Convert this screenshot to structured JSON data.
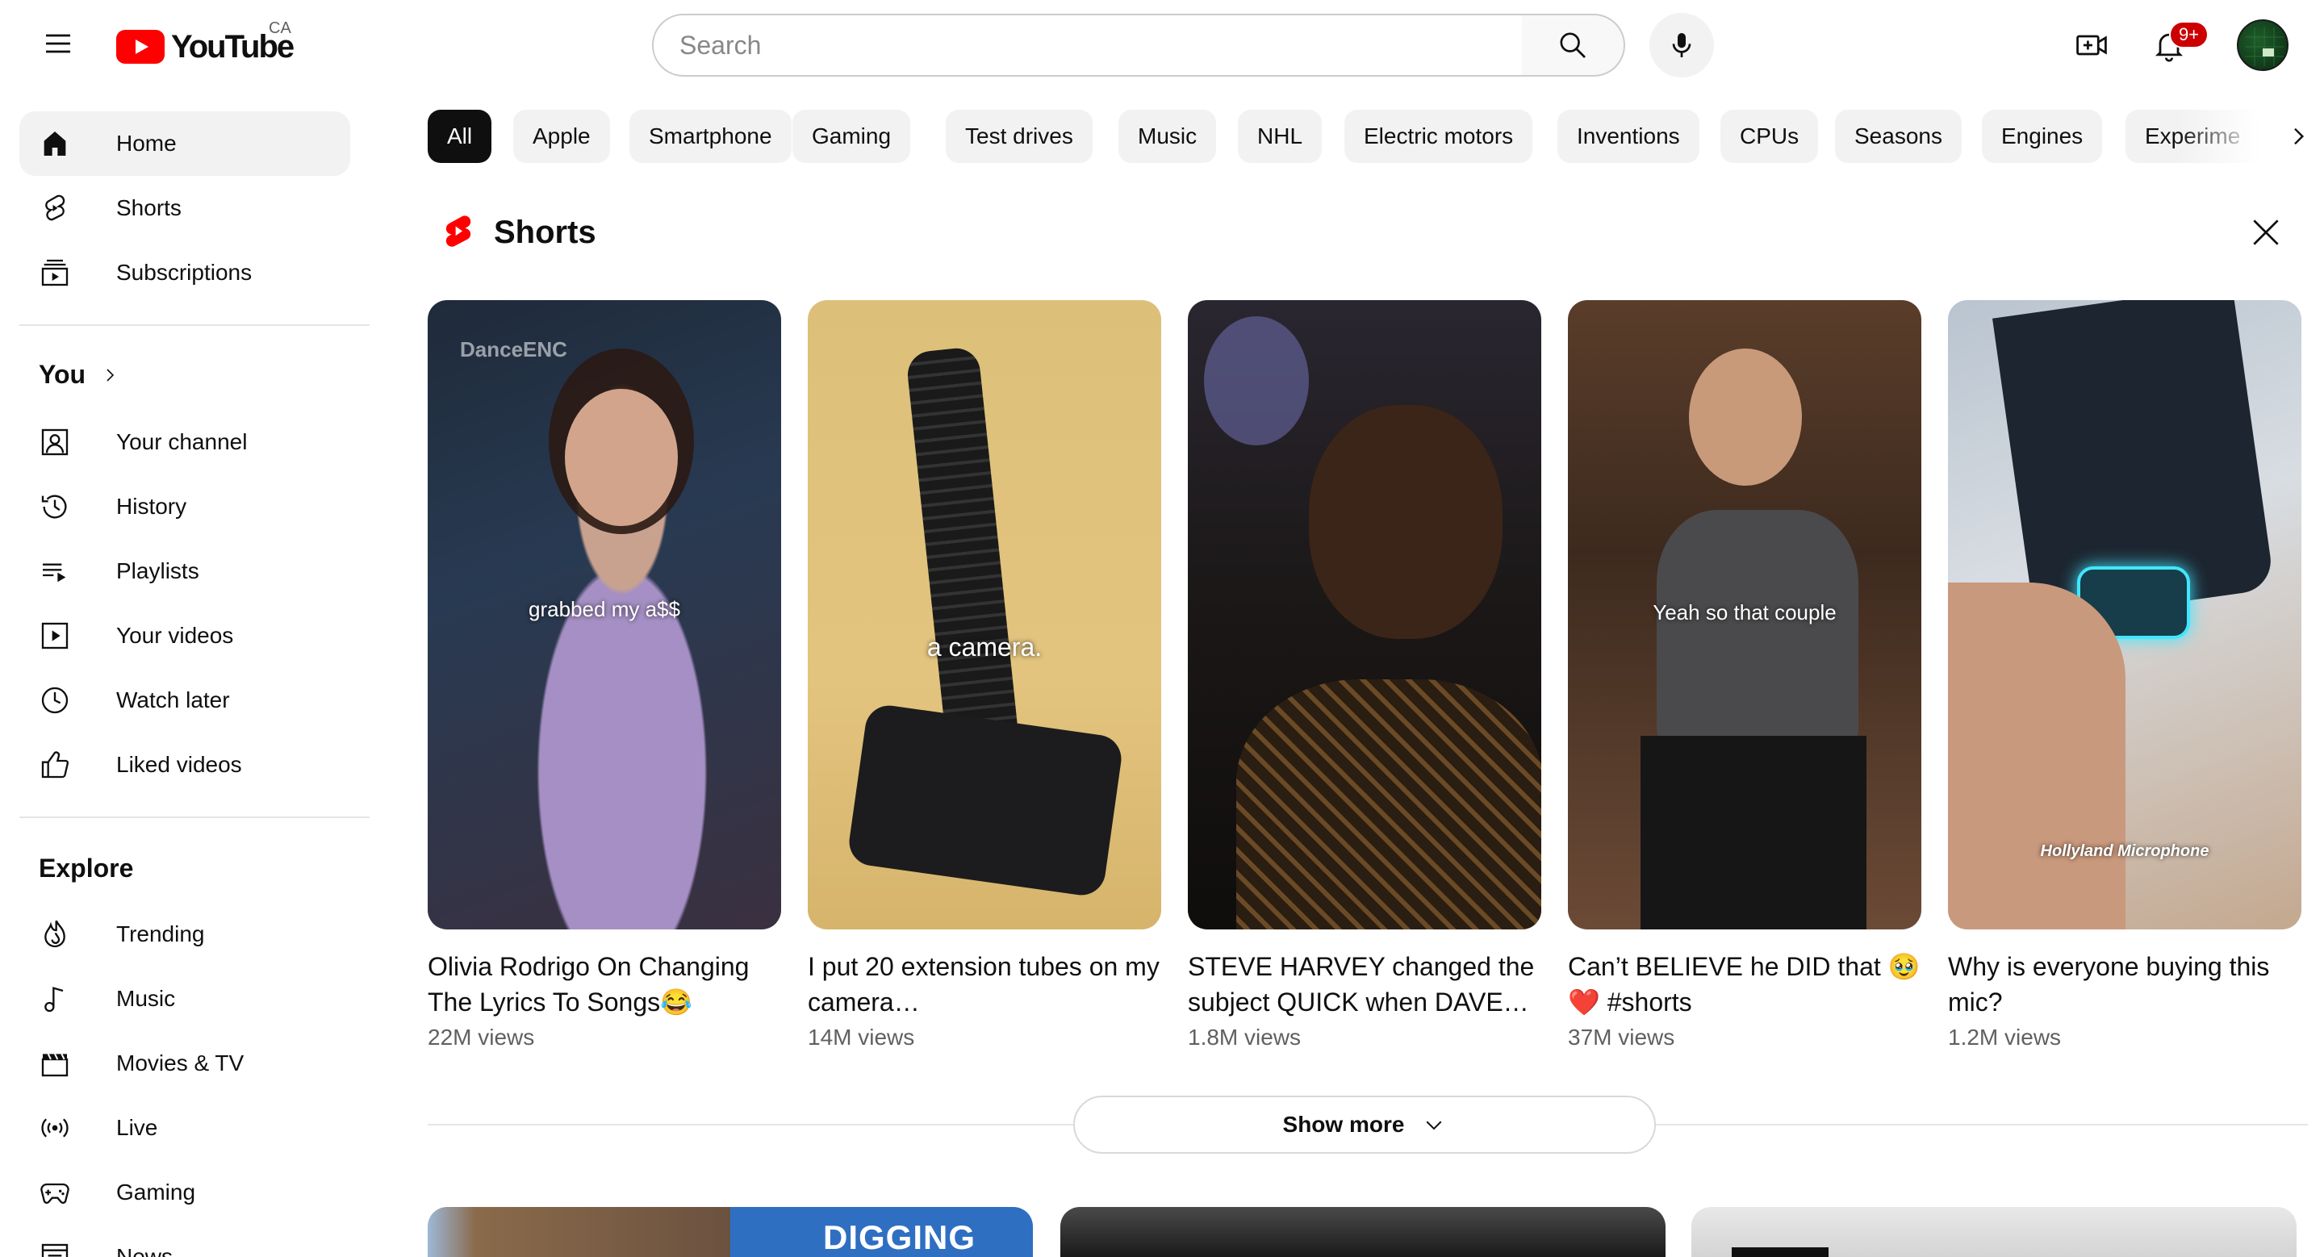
{
  "masthead": {
    "logo_text": "YouTube",
    "country_code": "CA",
    "search_placeholder": "Search",
    "notification_count": "9+"
  },
  "sidebar": {
    "primary": [
      {
        "label": "Home",
        "icon": "home-icon",
        "active": true
      },
      {
        "label": "Shorts",
        "icon": "shorts-icon"
      },
      {
        "label": "Subscriptions",
        "icon": "subscriptions-icon"
      }
    ],
    "you_heading": "You",
    "you_items": [
      {
        "label": "Your channel",
        "icon": "your-channel-icon"
      },
      {
        "label": "History",
        "icon": "history-icon"
      },
      {
        "label": "Playlists",
        "icon": "playlists-icon"
      },
      {
        "label": "Your videos",
        "icon": "your-videos-icon"
      },
      {
        "label": "Watch later",
        "icon": "watch-later-icon"
      },
      {
        "label": "Liked videos",
        "icon": "thumbs-up-icon"
      }
    ],
    "explore_heading": "Explore",
    "explore_items": [
      {
        "label": "Trending",
        "icon": "trending-icon"
      },
      {
        "label": "Music",
        "icon": "music-note-icon"
      },
      {
        "label": "Movies & TV",
        "icon": "clapperboard-icon"
      },
      {
        "label": "Live",
        "icon": "live-icon"
      },
      {
        "label": "Gaming",
        "icon": "gamepad-icon"
      },
      {
        "label": "News",
        "icon": "news-icon"
      }
    ]
  },
  "chips": [
    "All",
    "Apple",
    "Smartphone",
    "Gaming",
    "Test drives",
    "Music",
    "NHL",
    "Electric motors",
    "Inventions",
    "CPUs",
    "Seasons",
    "Engines",
    "Experime"
  ],
  "shorts": {
    "heading": "Shorts",
    "items": [
      {
        "title": "Olivia Rodrigo On Changing The Lyrics To Songs😂 #mus…",
        "views": "22M views",
        "caption": "grabbed my a$$",
        "watermark": "DanceENC"
      },
      {
        "title": "I put 20 extension tubes on my camera…",
        "views": "14M views",
        "caption": "a camera."
      },
      {
        "title": "STEVE HARVEY changed the subject QUICK when DAVE…",
        "views": "1.8M views",
        "caption": ""
      },
      {
        "title": "Can’t BELIEVE he DID that 🥹 ❤️ #shorts",
        "views": "37M views",
        "caption": "Yeah so that couple"
      },
      {
        "title": "Why is everyone buying this mic?",
        "views": "1.2M views",
        "caption": "Hollyland Microphone"
      }
    ],
    "show_more": "Show more"
  },
  "feed": {
    "first_thumb_text": "DIGGING UP"
  },
  "colors": {
    "brand_red": "#ff0000",
    "chip_bg": "#f2f2f2",
    "chip_selected_bg": "#0f0f0f",
    "secondary_text": "#606060"
  }
}
